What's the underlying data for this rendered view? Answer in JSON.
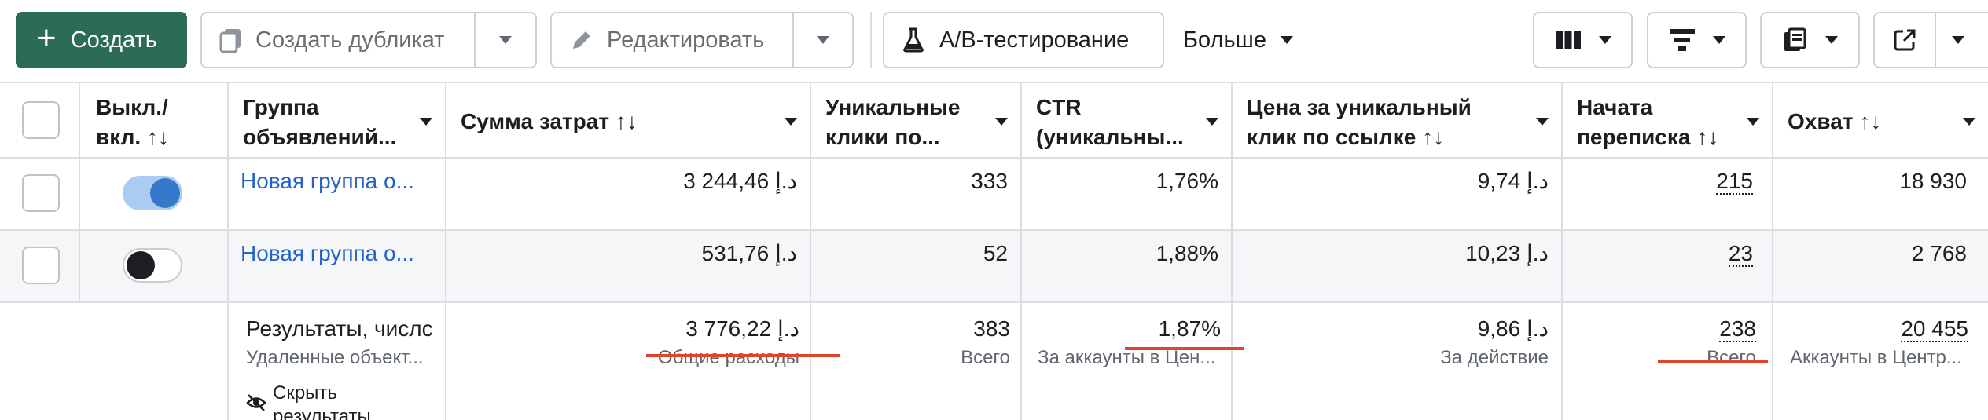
{
  "toolbar": {
    "create_label": "Создать",
    "duplicate_label": "Создать дубликат",
    "edit_label": "Редактировать",
    "ab_test_label": "A/B-тестирование",
    "more_label": "Больше"
  },
  "table": {
    "headers": {
      "toggle": "Выкл./ вкл. ↑↓",
      "adset": "Группа объявлений...",
      "spend": "Сумма затрат ↑↓",
      "unique_clicks": "Уникальные клики по...",
      "ctr": "CTR (уникальны...",
      "cost_per_click": "Цена за уникальный клик по ссылке ↑↓",
      "conversations": "Начата переписка ↑↓",
      "reach": "Охват ↑↓"
    },
    "rows": [
      {
        "name": "Новая группа о...",
        "spend": "3 244,46 د.إ",
        "unique_clicks": "333",
        "ctr": "1,76%",
        "cost_per_click": "9,74 د.إ",
        "conversations": "215",
        "reach": "18 930"
      },
      {
        "name": "Новая группа о...",
        "spend": "531,76 د.إ",
        "unique_clicks": "52",
        "ctr": "1,88%",
        "cost_per_click": "10,23 د.إ",
        "conversations": "23",
        "reach": "2 768"
      }
    ],
    "summary": {
      "title": "Результаты, числс",
      "subtitle": "Удаленные объект...",
      "hide_label": "Скрыть",
      "hide_label_2": "результаты",
      "spend": "3 776,22 د.إ",
      "spend_sub": "Общие расходы",
      "unique_clicks": "383",
      "unique_clicks_sub": "Всего",
      "ctr": "1,87%",
      "ctr_sub": "За аккаунты в Цен...",
      "cost_per_click": "9,86 د.إ",
      "cost_per_click_sub": "За действие",
      "conversations": "238",
      "conversations_sub": "Всего",
      "reach": "20 455",
      "reach_sub": "Аккаунты в Центр..."
    }
  },
  "colors": {
    "primary_green": "#2c6b57",
    "link_blue": "#2563c9",
    "toggle_on": "#3578c9",
    "annotation_red": "#e0452c"
  }
}
